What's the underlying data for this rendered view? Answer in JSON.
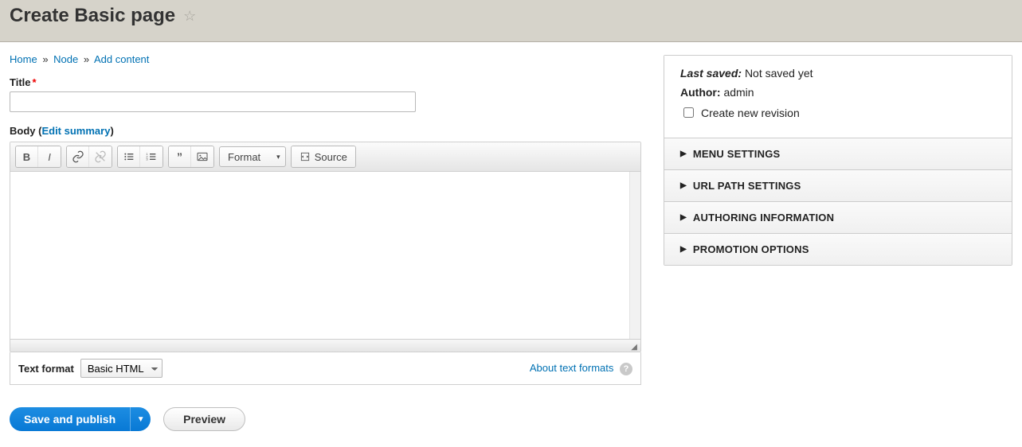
{
  "header": {
    "title": "Create Basic page"
  },
  "breadcrumb": {
    "home": "Home",
    "node": "Node",
    "add_content": "Add content",
    "sep": "»"
  },
  "title_field": {
    "label": "Title",
    "value": ""
  },
  "body_field": {
    "label_prefix": "Body (",
    "edit_summary": "Edit summary",
    "label_suffix": ")",
    "value": ""
  },
  "toolbar": {
    "format_btn": "Format",
    "source_btn": "Source"
  },
  "text_format": {
    "label": "Text format",
    "selected": "Basic HTML",
    "about_link": "About text formats"
  },
  "actions": {
    "save_publish": "Save and publish",
    "preview": "Preview"
  },
  "sidebar": {
    "last_saved_label": "Last saved:",
    "last_saved_value": "Not saved yet",
    "author_label": "Author:",
    "author_value": "admin",
    "revision_label": "Create new revision",
    "sections": [
      "MENU SETTINGS",
      "URL PATH SETTINGS",
      "AUTHORING INFORMATION",
      "PROMOTION OPTIONS"
    ]
  }
}
